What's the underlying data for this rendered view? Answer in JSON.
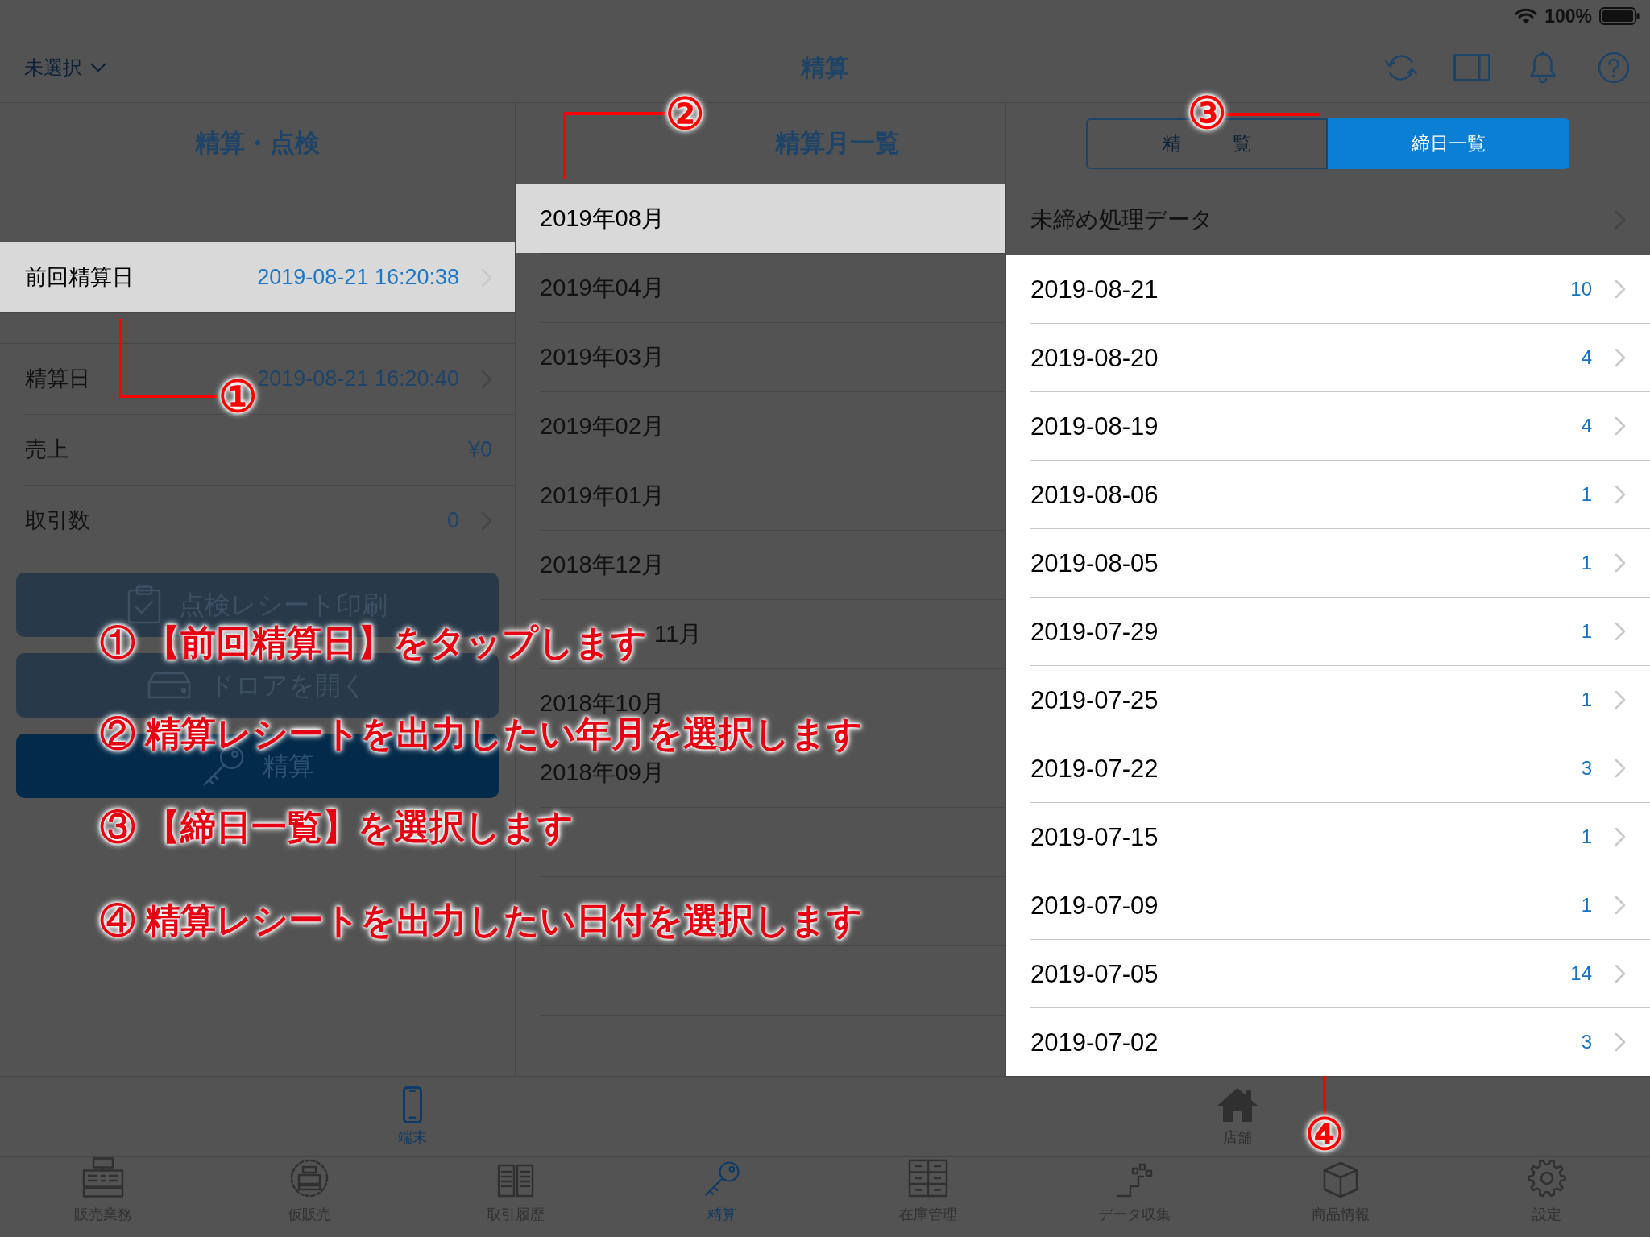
{
  "status_bar": {
    "battery": "100%"
  },
  "nav_bar": {
    "store_selector": "未選択",
    "title": "精算"
  },
  "left_panel": {
    "header": "精算・点検",
    "sections": [
      {
        "rows": [
          {
            "label": "前回精算日",
            "value": "2019-08-21 16:20:38",
            "chevron": true,
            "selected": true,
            "highlighted": true
          }
        ]
      },
      {
        "rows": [
          {
            "label": "精算日",
            "value": "2019-08-21 16:20:40",
            "chevron": true,
            "selected": false,
            "highlighted": false
          },
          {
            "label": "売上",
            "value": "¥0",
            "chevron": false,
            "selected": false,
            "highlighted": false
          },
          {
            "label": "取引数",
            "value": "0",
            "chevron": true,
            "selected": false,
            "highlighted": false
          }
        ]
      }
    ],
    "buttons": [
      {
        "label": "点検レシート印刷",
        "kind": "secondary"
      },
      {
        "label": "ドロアを開く",
        "kind": "secondary"
      },
      {
        "label": "精算",
        "kind": "primary"
      }
    ]
  },
  "month_panel": {
    "header": "精算月一覧",
    "months": [
      {
        "kind": "month",
        "label": "2019年08月",
        "selected": true,
        "highlighted": true
      },
      {
        "kind": "month",
        "label": "2019年04月",
        "selected": false,
        "highlighted": false
      },
      {
        "kind": "month",
        "label": "2019年03月",
        "selected": false,
        "highlighted": false
      },
      {
        "kind": "month",
        "label": "2019年02月",
        "selected": false,
        "highlighted": false
      },
      {
        "kind": "month",
        "label": "2019年01月",
        "selected": false,
        "highlighted": false
      },
      {
        "kind": "month",
        "label": "2018年12月",
        "selected": false,
        "highlighted": false
      },
      {
        "kind": "covered",
        "label": "11月",
        "selected": false,
        "highlighted": false
      },
      {
        "kind": "month",
        "label": "2018年10月",
        "selected": false,
        "highlighted": false
      },
      {
        "kind": "month",
        "label": "2018年09月",
        "selected": false,
        "highlighted": false
      }
    ]
  },
  "closing_panel": {
    "segments": [
      {
        "label": "精 覧",
        "selected": false,
        "highlighted": false
      },
      {
        "label": "締日一覧",
        "selected": true,
        "highlighted": true
      }
    ],
    "pending_row": {
      "label": "未締め処理データ"
    },
    "date_list": {
      "highlighted": true,
      "rows": [
        {
          "date": "2019-08-21",
          "count": "10"
        },
        {
          "date": "2019-08-20",
          "count": "4"
        },
        {
          "date": "2019-08-19",
          "count": "4"
        },
        {
          "date": "2019-08-06",
          "count": "1"
        },
        {
          "date": "2019-08-05",
          "count": "1"
        },
        {
          "date": "2019-07-29",
          "count": "1"
        },
        {
          "date": "2019-07-25",
          "count": "1"
        },
        {
          "date": "2019-07-22",
          "count": "3"
        },
        {
          "date": "2019-07-15",
          "count": "1"
        },
        {
          "date": "2019-07-09",
          "count": "1"
        },
        {
          "date": "2019-07-05",
          "count": "14"
        },
        {
          "date": "2019-07-02",
          "count": "3"
        }
      ]
    }
  },
  "tab_bar": {
    "groups": [
      {
        "label": "端末",
        "selected": true
      },
      {
        "label": "店舗",
        "selected": false
      }
    ],
    "tabs": [
      {
        "label": "販売業務",
        "selected": false
      },
      {
        "label": "仮販売",
        "selected": false
      },
      {
        "label": "取引履歴",
        "selected": false
      },
      {
        "label": "精算",
        "selected": true
      },
      {
        "label": "在庫管理",
        "selected": false
      },
      {
        "label": "データ収集",
        "selected": false
      },
      {
        "label": "商品情報",
        "selected": false
      },
      {
        "label": "設定",
        "selected": false
      }
    ]
  },
  "annotations": {
    "callouts": [
      "①",
      "②",
      "③",
      "④"
    ],
    "instructions": [
      "① 【前回精算日】をタップします",
      "② 精算レシートを出力したい年月を選択します",
      "③ 【締日一覧】を選択します",
      "④ 精算レシートを出力したい日付を選択します"
    ]
  }
}
